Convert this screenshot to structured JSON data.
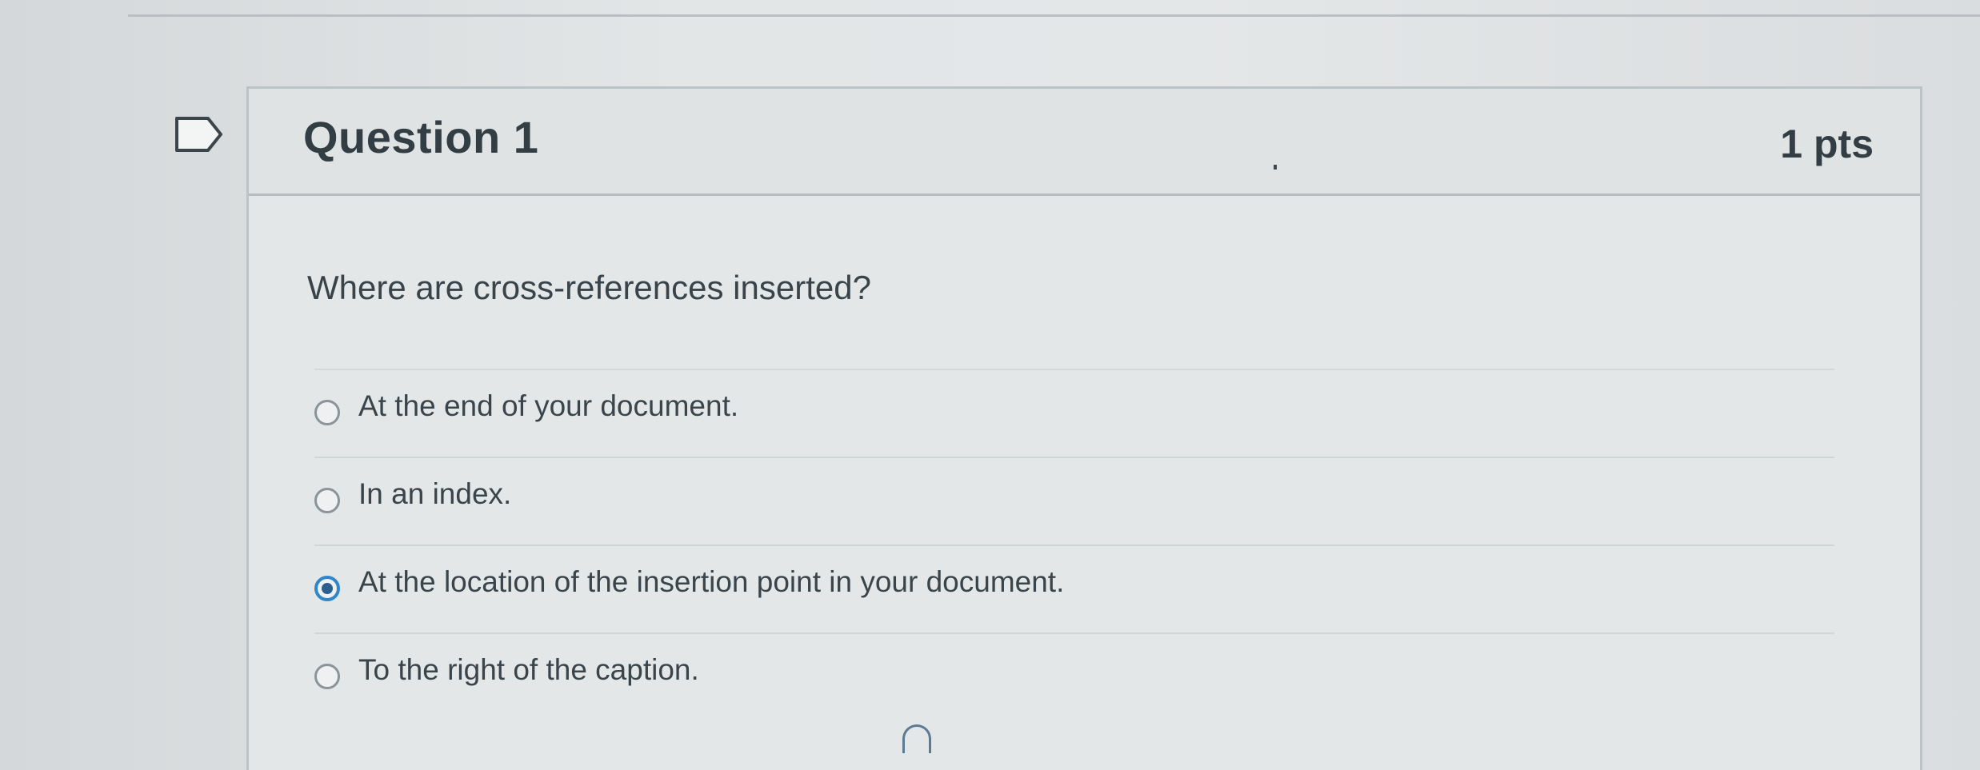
{
  "question": {
    "title": "Question 1",
    "points": "1 pts",
    "text": "Where are cross-references inserted?",
    "flag_icon": "flag-outline-icon"
  },
  "answers": [
    {
      "label": "At the end of your document.",
      "selected": false
    },
    {
      "label": "In an index.",
      "selected": false
    },
    {
      "label": "At the location of the insertion point in your document.",
      "selected": true
    },
    {
      "label": "To the right of the caption.",
      "selected": false
    }
  ],
  "colors": {
    "accent": "#2f86c9",
    "text": "#2d3b45",
    "border": "#bcc3c7"
  }
}
